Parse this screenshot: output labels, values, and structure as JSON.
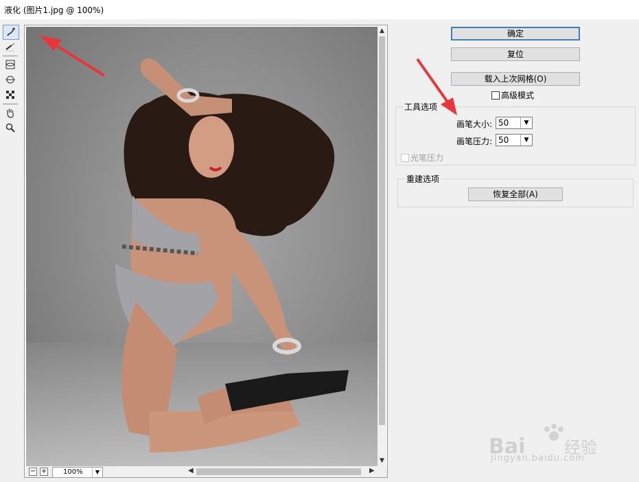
{
  "window": {
    "title": "液化 (图片1.jpg @ 100%)"
  },
  "tools": [
    {
      "icon": "warp-brush-icon"
    },
    {
      "icon": "reconstruct-icon"
    },
    {
      "icon": "pucker-icon"
    },
    {
      "icon": "bloat-icon"
    },
    {
      "icon": "freeze-mask-icon"
    },
    {
      "icon": "hand-icon"
    },
    {
      "icon": "zoom-icon"
    }
  ],
  "preview": {
    "zoom_value": "100%",
    "zoom_out": "−",
    "zoom_in": "+"
  },
  "buttons": {
    "ok": "确定",
    "reset": "复位",
    "load_mesh": "载入上次网格(O)",
    "restore_all": "恢复全部(A)"
  },
  "advanced_mode": {
    "label": "高级模式",
    "checked": false
  },
  "tool_options": {
    "title": "工具选项",
    "brush_size_label": "画笔大小:",
    "brush_size_value": "50",
    "brush_pressure_label": "画笔压力:",
    "brush_pressure_value": "50",
    "stylus_pressure_label": "光笔压力",
    "stylus_pressure_checked": false
  },
  "reconstruct_options": {
    "title": "重建选项"
  },
  "annotations": {
    "arrow_color": "#e8363a"
  },
  "watermark": {
    "brand": "Baidu经验",
    "url": "jingyan.baidu.com"
  }
}
